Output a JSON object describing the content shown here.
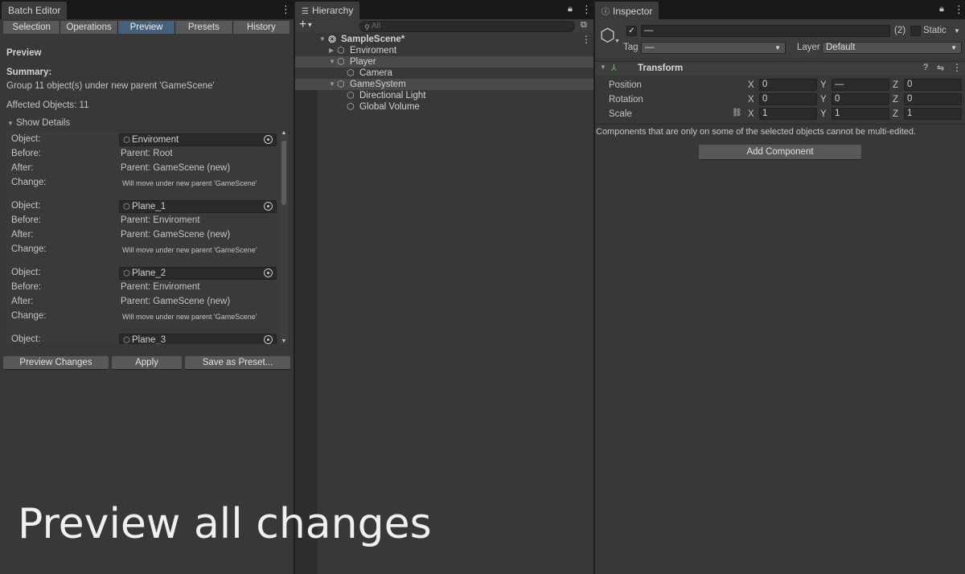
{
  "batch": {
    "tab_title": "Batch Editor",
    "tabs": [
      "Selection",
      "Operations",
      "Preview",
      "Presets",
      "History"
    ],
    "active_tab": "Preview",
    "heading": "Preview",
    "summary_label": "Summary:",
    "summary_text": "Group 11 object(s) under new parent 'GameScene'",
    "affected": "Affected Objects: 11",
    "show_details": "Show Details",
    "row_labels": {
      "object": "Object:",
      "before": "Before:",
      "after": "After:",
      "change": "Change:"
    },
    "details": [
      {
        "object": "Enviroment",
        "before": "Parent: Root",
        "after": "Parent: GameScene (new)",
        "change": "Will move under new parent 'GameScene'"
      },
      {
        "object": "Plane_1",
        "before": "Parent: Enviroment",
        "after": "Parent: GameScene (new)",
        "change": "Will move under new parent 'GameScene'"
      },
      {
        "object": "Plane_2",
        "before": "Parent: Enviroment",
        "after": "Parent: GameScene (new)",
        "change": "Will move under new parent 'GameScene'"
      },
      {
        "object": "Plane_3",
        "before": "",
        "after": "",
        "change": ""
      }
    ],
    "buttons": {
      "preview": "Preview Changes",
      "apply": "Apply",
      "save_preset": "Save as Preset..."
    },
    "caption": "Preview all changes"
  },
  "hierarchy": {
    "tab_title": "Hierarchy",
    "search_placeholder": "All",
    "scene": "SampleScene*",
    "items": [
      {
        "label": "Enviroment",
        "expanded": false,
        "highlight": false
      },
      {
        "label": "Player",
        "expanded": true,
        "highlight": true
      },
      {
        "label": "Camera",
        "highlight": false
      },
      {
        "label": "GameSystem",
        "expanded": true,
        "highlight": true
      },
      {
        "label": "Directional Light",
        "highlight": false
      },
      {
        "label": "Global Volume",
        "highlight": false
      }
    ]
  },
  "inspector": {
    "tab_title": "Inspector",
    "name_value": "—",
    "multi_count": "(2)",
    "static_label": "Static",
    "tag_label": "Tag",
    "tag_value": "—",
    "layer_label": "Layer",
    "layer_value": "Default",
    "component_title": "Transform",
    "position_label": "Position",
    "rotation_label": "Rotation",
    "scale_label": "Scale",
    "axes": {
      "x": "X",
      "y": "Y",
      "z": "Z"
    },
    "position": {
      "x": "0",
      "y": "—",
      "z": "0"
    },
    "rotation": {
      "x": "0",
      "y": "0",
      "z": "0"
    },
    "scale": {
      "x": "1",
      "y": "1",
      "z": "1"
    },
    "warning": "Components that are only on some of the selected objects cannot be multi-edited.",
    "add_component": "Add Component"
  },
  "colors": {
    "active_tab": "#46607c",
    "panel": "#383838",
    "background": "#282828"
  }
}
